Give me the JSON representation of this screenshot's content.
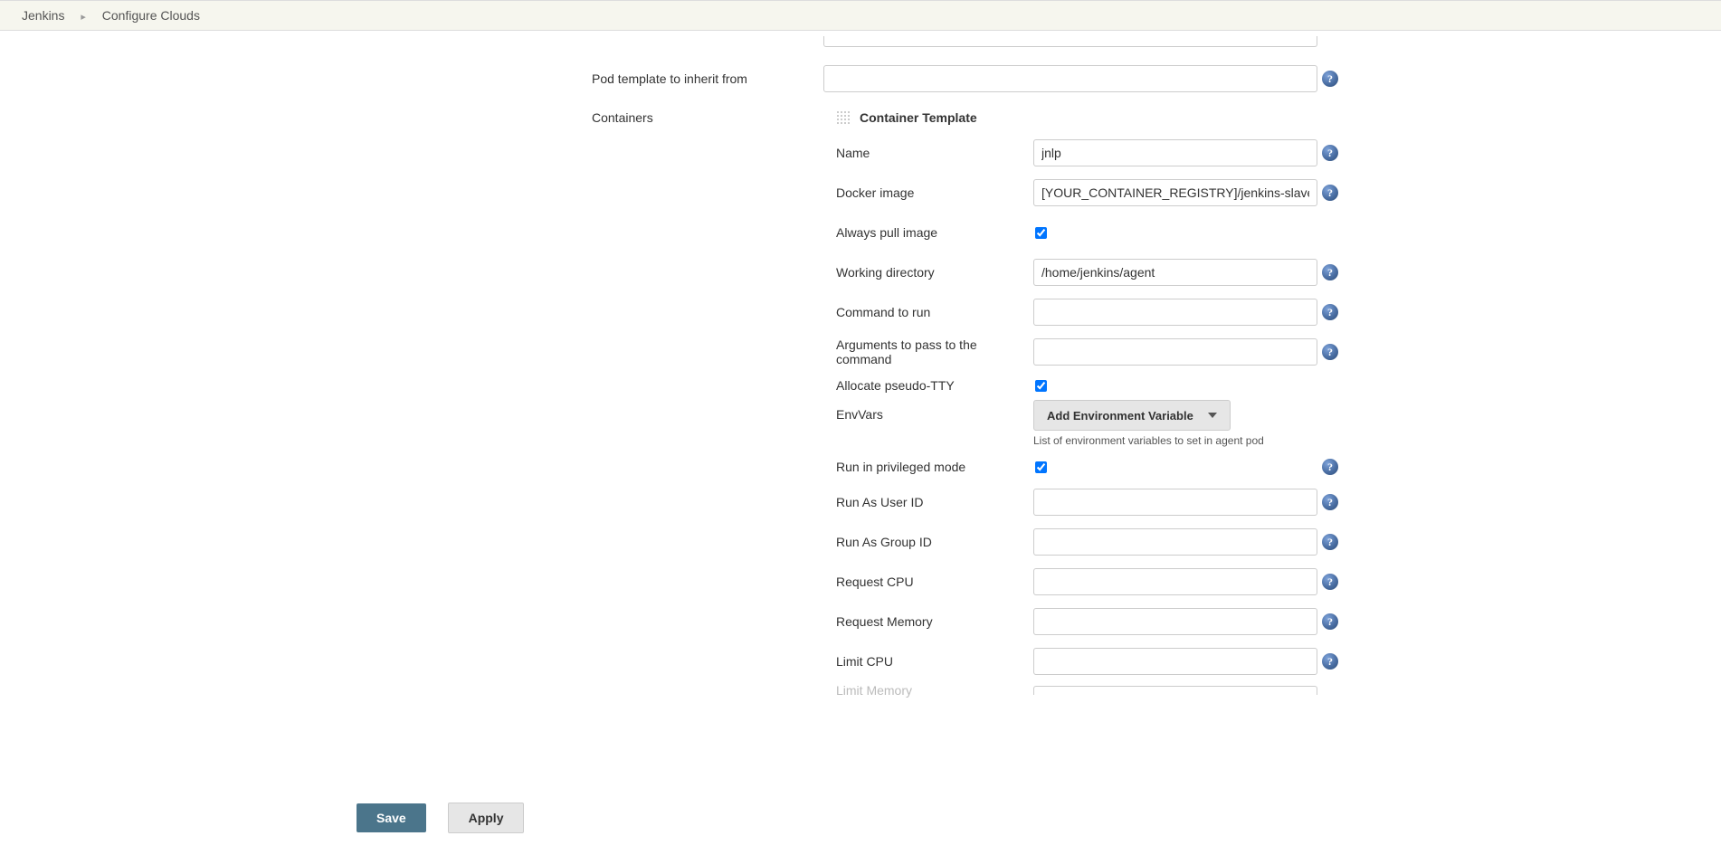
{
  "breadcrumb": {
    "home": "Jenkins",
    "current": "Configure Clouds"
  },
  "form": {
    "pod_template_inherit_label": "Pod template to inherit from",
    "pod_template_inherit_value": "",
    "containers_label": "Containers",
    "container_template_title": "Container Template",
    "fields": {
      "name_label": "Name",
      "name_value": "jnlp",
      "docker_image_label": "Docker image",
      "docker_image_value": "[YOUR_CONTAINER_REGISTRY]/jenkins-slave",
      "always_pull_label": "Always pull image",
      "always_pull_checked": true,
      "working_dir_label": "Working directory",
      "working_dir_value": "/home/jenkins/agent",
      "command_label": "Command to run",
      "command_value": "",
      "args_label": "Arguments to pass to the command",
      "args_value": "",
      "allocate_tty_label": "Allocate pseudo-TTY",
      "allocate_tty_checked": true,
      "envvars_label": "EnvVars",
      "envvars_button": "Add Environment Variable",
      "envvars_help": "List of environment variables to set in agent pod",
      "privileged_label": "Run in privileged mode",
      "privileged_checked": true,
      "run_as_user_label": "Run As User ID",
      "run_as_user_value": "",
      "run_as_group_label": "Run As Group ID",
      "run_as_group_value": "",
      "request_cpu_label": "Request CPU",
      "request_cpu_value": "",
      "request_memory_label": "Request Memory",
      "request_memory_value": "",
      "limit_cpu_label": "Limit CPU",
      "limit_cpu_value": "",
      "limit_memory_label": "Limit Memory"
    }
  },
  "buttons": {
    "save": "Save",
    "apply": "Apply"
  }
}
